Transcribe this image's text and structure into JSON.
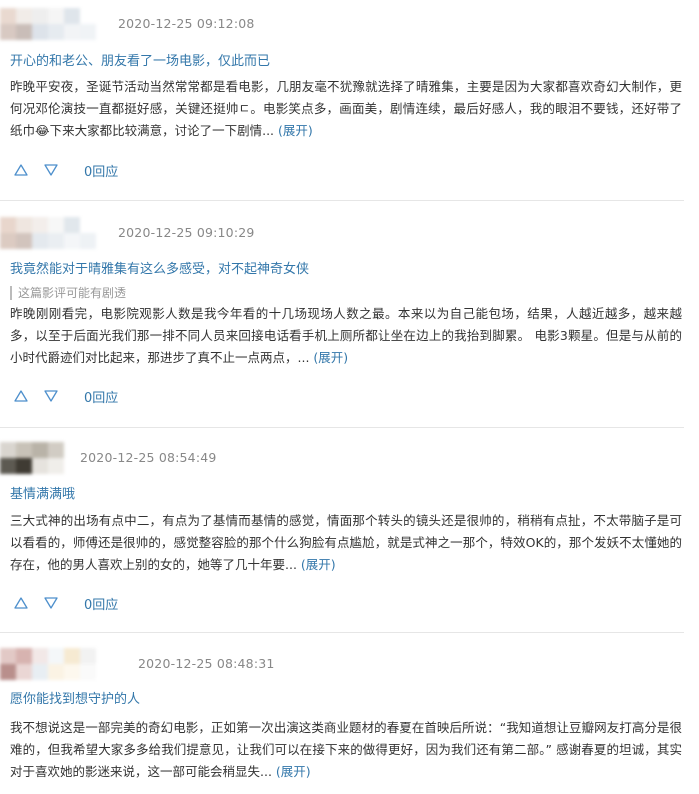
{
  "reviews": [
    {
      "timestamp": "2020-12-25 09:12:08",
      "title": "开心的和老公、朋友看了一场电影，仅此而已",
      "flag": "",
      "body": "昨晚平安夜，圣诞节活动当然常常都是看电影，几朋友毫不犹豫就选择了晴雅集，主要是因为大家都喜欢奇幻大制作，更何况邓伦演技一直都挺好感，关键还挺帅ㄷ。电影笑点多，画面美，剧情连续，最后好感人，我的眼泪不要钱，还好带了纸巾😂下来大家都比较满意，讨论了一下剧情... ",
      "expand_label": "(展开)",
      "reply_label": "0回应",
      "avatar_colors": [
        "#e9d9d0",
        "#d8c9c2",
        "#f1ece8",
        "#c9bdb8",
        "#eeeeee",
        "#dde3ea",
        "#f5f5f5",
        "#e6ebf0",
        "#dfe5eb",
        "#f2f4f6",
        "#ffffff",
        "#f0f3f6"
      ]
    },
    {
      "timestamp": "2020-12-25 09:10:29",
      "title": "我竟然能对于晴雅集有这么多感受，对不起神奇女侠",
      "flag": "这篇影评可能有剧透",
      "body": "昨晚刚刚看完，电影院观影人数是我今年看的十几场现场人数之最。本来以为自己能包场，结果，人越近越多，越来越多，以至于后面光我们那一排不同人员来回接电话看手机上厕所都让坐在边上的我抬到脚累。 电影3颗星。但是与从前的小时代爵迹们对比起来，那进步了真不止一点两点，... ",
      "expand_label": "(展开)",
      "reply_label": "0回应",
      "avatar_colors": [
        "#e8d6cc",
        "#dccbc2",
        "#efe6e0",
        "#d2c4bd",
        "#f3eeeb",
        "#e4e9ee",
        "#f7f7f7",
        "#eaeef2",
        "#e1e7ec",
        "#f4f6f8",
        "#ffffff",
        "#eef2f5"
      ]
    },
    {
      "timestamp": "2020-12-25 08:54:49",
      "title": "基情满满哦",
      "flag": "",
      "body": "三大式神的出场有点中二，有点为了基情而基情的感觉，情面那个转头的镜头还是很帅的，稍稍有点扯，不太带脑子是可以看看的，师傅还是很帅的，感觉整容脸的那个什么狗脸有点尴尬，就是式神之一那个，特效OK的，那个发妖不太懂她的存在，他的男人喜欢上别的女的，她等了几十年要... ",
      "expand_label": "(展开)",
      "reply_label": "0回应",
      "avatar_colors": [
        "#d9d5cf",
        "#5d5a52",
        "#c8c2b8",
        "#3f3b33",
        "#b9b3a8",
        "#e6e3de",
        "#d1ccc4",
        "#f0eeea"
      ]
    },
    {
      "timestamp": "2020-12-25 08:48:31",
      "title": "愿你能找到想守护的人",
      "flag": "",
      "body": "我不想说这是一部完美的奇幻电影，正如第一次出演这类商业题材的春夏在首映后所说：“我知道想让豆瓣网友打高分是很难的，但我希望大家多多给我们提意见，让我们可以在接下来的做得更好，因为我们还有第二部。” 感谢春夏的坦诚，其实对于喜欢她的影迷来说，这一部可能会稍显失... ",
      "expand_label": "(展开)",
      "reply_label": "",
      "avatar_colors": [
        "#e2c9c6",
        "#b98f8c",
        "#d7b3b0",
        "#ead6d4",
        "#f2e8e7",
        "#e8eef3",
        "#f4f7f9",
        "#fbf3e4",
        "#f6ead2",
        "#fdf8ee",
        "#f2f2f2",
        "#fafafa"
      ]
    }
  ],
  "icons": {
    "upvote": "triangle-up-icon",
    "downvote": "triangle-down-icon"
  },
  "colors": {
    "link": "#3377aa",
    "meta": "#888888",
    "text": "#333333",
    "icon": "#4d8fcc"
  }
}
